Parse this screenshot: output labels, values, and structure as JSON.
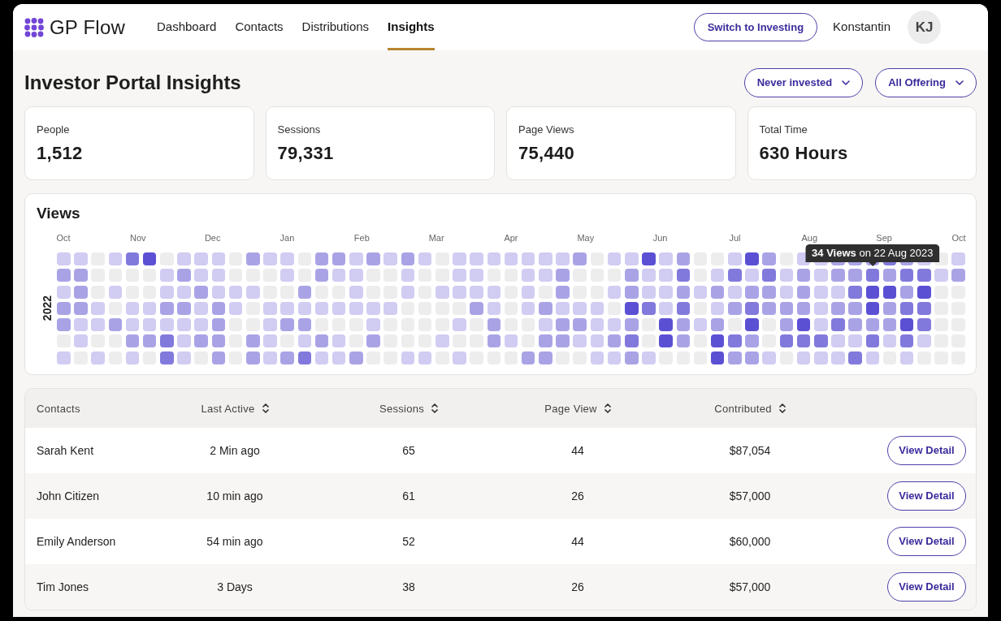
{
  "header": {
    "brand": "GP Flow",
    "nav": [
      {
        "label": "Dashboard",
        "selected": false
      },
      {
        "label": "Contacts",
        "selected": false
      },
      {
        "label": "Distributions",
        "selected": false
      },
      {
        "label": "Insights",
        "selected": true
      }
    ],
    "switch_button": "Switch to Investing",
    "user_name": "Konstantin",
    "avatar_initials": "KJ"
  },
  "page_title": "Investor Portal Insights",
  "filters": [
    {
      "label": "Never invested"
    },
    {
      "label": "All Offering"
    }
  ],
  "stats": [
    {
      "label": "People",
      "value": "1,512"
    },
    {
      "label": "Sessions",
      "value": "79,331"
    },
    {
      "label": "Page Views",
      "value": "75,440"
    },
    {
      "label": "Total Time",
      "value": "630 Hours"
    }
  ],
  "views": {
    "title": "Views",
    "year": "2022",
    "months": [
      "Oct",
      "Nov",
      "Dec",
      "Jan",
      "Feb",
      "Mar",
      "Apr",
      "May",
      "Jun",
      "Jul",
      "Aug",
      "Sep",
      "Oct"
    ],
    "rows": [
      {
        "cells": [
          {
            "color": "#d0ccf2"
          },
          {
            "color": "#d0ccf2"
          },
          {
            "color": "#ededed"
          },
          {
            "color": "#d0ccf2"
          },
          {
            "color": "#8279dc"
          },
          {
            "color": "#5b50d4"
          },
          {
            "color": "#ededed"
          },
          {
            "color": "#d0ccf2"
          },
          {
            "color": "#d0ccf2"
          },
          {
            "color": "#d0ccf2"
          },
          {
            "color": "#ededed"
          },
          {
            "color": "#a9a3e6"
          },
          {
            "color": "#d0ccf2"
          },
          {
            "color": "#d0ccf2"
          },
          {
            "color": "#ededed"
          },
          {
            "color": "#a9a3e6"
          },
          {
            "color": "#a9a3e6"
          },
          {
            "color": "#d0ccf2"
          },
          {
            "color": "#a9a3e6"
          },
          {
            "color": "#d0ccf2"
          },
          {
            "color": "#a9a3e6"
          },
          {
            "color": "#d0ccf2"
          },
          {
            "color": "#ededed"
          },
          {
            "color": "#d0ccf2"
          },
          {
            "color": "#d0ccf2"
          },
          {
            "color": "#d0ccf2"
          },
          {
            "color": "#d0ccf2"
          },
          {
            "color": "#d0ccf2"
          },
          {
            "color": "#d0ccf2"
          },
          {
            "color": "#d0ccf2"
          },
          {
            "color": "#a9a3e6"
          },
          {
            "color": "#ededed"
          },
          {
            "color": "#d0ccf2"
          },
          {
            "color": "#d0ccf2"
          },
          {
            "color": "#5b50d4"
          },
          {
            "color": "#d0ccf2"
          },
          {
            "color": "#a9a3e6"
          },
          {
            "color": "#ededed"
          },
          {
            "color": "#ededed"
          },
          {
            "color": "#d0ccf2"
          },
          {
            "color": "#5b50d4"
          },
          {
            "color": "#a9a3e6"
          },
          {
            "color": "#ededed"
          },
          {
            "color": "#d0ccf2"
          },
          {
            "color": "#d0ccf2"
          },
          {
            "color": "#a9a3e6"
          },
          {
            "color": "#a9a3e6"
          },
          {
            "color": "#a9a3e6"
          },
          {
            "color": "#8279dc"
          },
          {
            "color": "#a9a3e6"
          },
          {
            "color": "#d0ccf2"
          },
          {
            "color": "#ededed"
          },
          {
            "color": "#d0ccf2"
          }
        ]
      },
      {
        "cells": [
          {
            "color": "#a9a3e6"
          },
          {
            "color": "#a9a3e6"
          },
          {
            "color": "#ededed"
          },
          {
            "color": "#ededed"
          },
          {
            "color": "#ededed"
          },
          {
            "color": "#ededed"
          },
          {
            "color": "#d0ccf2"
          },
          {
            "color": "#a9a3e6"
          },
          {
            "color": "#d0ccf2"
          },
          {
            "color": "#d0ccf2"
          },
          {
            "color": "#ededed"
          },
          {
            "color": "#ededed"
          },
          {
            "color": "#ededed"
          },
          {
            "color": "#d0ccf2"
          },
          {
            "color": "#ededed"
          },
          {
            "color": "#a9a3e6"
          },
          {
            "color": "#d0ccf2"
          },
          {
            "color": "#d0ccf2"
          },
          {
            "color": "#ededed"
          },
          {
            "color": "#ededed"
          },
          {
            "color": "#d0ccf2"
          },
          {
            "color": "#ededed"
          },
          {
            "color": "#ededed"
          },
          {
            "color": "#d0ccf2"
          },
          {
            "color": "#d0ccf2"
          },
          {
            "color": "#ededed"
          },
          {
            "color": "#ededed"
          },
          {
            "color": "#d0ccf2"
          },
          {
            "color": "#d0ccf2"
          },
          {
            "color": "#a9a3e6"
          },
          {
            "color": "#ededed"
          },
          {
            "color": "#ededed"
          },
          {
            "color": "#ededed"
          },
          {
            "color": "#a9a3e6"
          },
          {
            "color": "#d0ccf2"
          },
          {
            "color": "#d0ccf2"
          },
          {
            "color": "#8279dc"
          },
          {
            "color": "#ededed"
          },
          {
            "color": "#d0ccf2"
          },
          {
            "color": "#8279dc"
          },
          {
            "color": "#d0ccf2"
          },
          {
            "color": "#8279dc"
          },
          {
            "color": "#d0ccf2"
          },
          {
            "color": "#a9a3e6"
          },
          {
            "color": "#d0ccf2"
          },
          {
            "color": "#a9a3e6"
          },
          {
            "color": "#a9a3e6"
          },
          {
            "color": "#8279dc",
            "tooltip": "**34 Views** on 22 Aug 2023"
          },
          {
            "color": "#a9a3e6"
          },
          {
            "color": "#8279dc"
          },
          {
            "color": "#8279dc"
          },
          {
            "color": "#d0ccf2"
          },
          {
            "color": "#a9a3e6"
          }
        ]
      },
      {
        "cells": [
          {
            "color": "#d0ccf2"
          },
          {
            "color": "#a9a3e6"
          },
          {
            "color": "#ededed"
          },
          {
            "color": "#d0ccf2"
          },
          {
            "color": "#ededed"
          },
          {
            "color": "#ededed"
          },
          {
            "color": "#d0ccf2"
          },
          {
            "color": "#d0ccf2"
          },
          {
            "color": "#a9a3e6"
          },
          {
            "color": "#d0ccf2"
          },
          {
            "color": "#d0ccf2"
          },
          {
            "color": "#d0ccf2"
          },
          {
            "color": "#ededed"
          },
          {
            "color": "#ededed"
          },
          {
            "color": "#a9a3e6"
          },
          {
            "color": "#ededed"
          },
          {
            "color": "#ededed"
          },
          {
            "color": "#d0ccf2"
          },
          {
            "color": "#ededed"
          },
          {
            "color": "#ededed"
          },
          {
            "color": "#d0ccf2"
          },
          {
            "color": "#ededed"
          },
          {
            "color": "#d0ccf2"
          },
          {
            "color": "#d0ccf2"
          },
          {
            "color": "#d0ccf2"
          },
          {
            "color": "#d0ccf2"
          },
          {
            "color": "#ededed"
          },
          {
            "color": "#d0ccf2"
          },
          {
            "color": "#ededed"
          },
          {
            "color": "#a9a3e6"
          },
          {
            "color": "#ededed"
          },
          {
            "color": "#ededed"
          },
          {
            "color": "#d0ccf2"
          },
          {
            "color": "#a9a3e6"
          },
          {
            "color": "#d0ccf2"
          },
          {
            "color": "#d0ccf2"
          },
          {
            "color": "#a9a3e6"
          },
          {
            "color": "#d0ccf2"
          },
          {
            "color": "#a9a3e6"
          },
          {
            "color": "#d0ccf2"
          },
          {
            "color": "#a9a3e6"
          },
          {
            "color": "#a9a3e6"
          },
          {
            "color": "#d0ccf2"
          },
          {
            "color": "#a9a3e6"
          },
          {
            "color": "#d0ccf2"
          },
          {
            "color": "#d0ccf2"
          },
          {
            "color": "#8279dc"
          },
          {
            "color": "#5b50d4"
          },
          {
            "color": "#5b50d4"
          },
          {
            "color": "#a9a3e6"
          },
          {
            "color": "#5b50d4"
          },
          {
            "color": "#ededed"
          },
          {
            "color": "#ededed"
          }
        ]
      },
      {
        "cells": [
          {
            "color": "#a9a3e6"
          },
          {
            "color": "#a9a3e6"
          },
          {
            "color": "#d0ccf2"
          },
          {
            "color": "#ededed"
          },
          {
            "color": "#d0ccf2"
          },
          {
            "color": "#d0ccf2"
          },
          {
            "color": "#a9a3e6"
          },
          {
            "color": "#a9a3e6"
          },
          {
            "color": "#d0ccf2"
          },
          {
            "color": "#a9a3e6"
          },
          {
            "color": "#d0ccf2"
          },
          {
            "color": "#ededed"
          },
          {
            "color": "#d0ccf2"
          },
          {
            "color": "#d0ccf2"
          },
          {
            "color": "#d0ccf2"
          },
          {
            "color": "#d0ccf2"
          },
          {
            "color": "#d0ccf2"
          },
          {
            "color": "#d0ccf2"
          },
          {
            "color": "#d0ccf2"
          },
          {
            "color": "#d0ccf2"
          },
          {
            "color": "#ededed"
          },
          {
            "color": "#ededed"
          },
          {
            "color": "#ededed"
          },
          {
            "color": "#ededed"
          },
          {
            "color": "#a9a3e6"
          },
          {
            "color": "#d0ccf2"
          },
          {
            "color": "#ededed"
          },
          {
            "color": "#d0ccf2"
          },
          {
            "color": "#a9a3e6"
          },
          {
            "color": "#d0ccf2"
          },
          {
            "color": "#d0ccf2"
          },
          {
            "color": "#d0ccf2"
          },
          {
            "color": "#ededed"
          },
          {
            "color": "#5b50d4"
          },
          {
            "color": "#8279dc"
          },
          {
            "color": "#d0ccf2"
          },
          {
            "color": "#8279dc"
          },
          {
            "color": "#ededed"
          },
          {
            "color": "#d0ccf2"
          },
          {
            "color": "#a9a3e6"
          },
          {
            "color": "#8279dc"
          },
          {
            "color": "#a9a3e6"
          },
          {
            "color": "#a9a3e6"
          },
          {
            "color": "#a9a3e6"
          },
          {
            "color": "#d0ccf2"
          },
          {
            "color": "#a9a3e6"
          },
          {
            "color": "#a9a3e6"
          },
          {
            "color": "#5b50d4"
          },
          {
            "color": "#a9a3e6"
          },
          {
            "color": "#8279dc"
          },
          {
            "color": "#8279dc"
          },
          {
            "color": "#ededed"
          },
          {
            "color": "#ededed"
          }
        ]
      },
      {
        "cells": [
          {
            "color": "#a9a3e6"
          },
          {
            "color": "#d0ccf2"
          },
          {
            "color": "#d0ccf2"
          },
          {
            "color": "#a9a3e6"
          },
          {
            "color": "#d0ccf2"
          },
          {
            "color": "#d0ccf2"
          },
          {
            "color": "#d0ccf2"
          },
          {
            "color": "#d0ccf2"
          },
          {
            "color": "#d0ccf2"
          },
          {
            "color": "#a9a3e6"
          },
          {
            "color": "#ededed"
          },
          {
            "color": "#ededed"
          },
          {
            "color": "#d0ccf2"
          },
          {
            "color": "#a9a3e6"
          },
          {
            "color": "#a9a3e6"
          },
          {
            "color": "#ededed"
          },
          {
            "color": "#ededed"
          },
          {
            "color": "#ededed"
          },
          {
            "color": "#d0ccf2"
          },
          {
            "color": "#ededed"
          },
          {
            "color": "#ededed"
          },
          {
            "color": "#ededed"
          },
          {
            "color": "#ededed"
          },
          {
            "color": "#d0ccf2"
          },
          {
            "color": "#ededed"
          },
          {
            "color": "#a9a3e6"
          },
          {
            "color": "#ededed"
          },
          {
            "color": "#ededed"
          },
          {
            "color": "#d0ccf2"
          },
          {
            "color": "#a9a3e6"
          },
          {
            "color": "#a9a3e6"
          },
          {
            "color": "#d0ccf2"
          },
          {
            "color": "#d0ccf2"
          },
          {
            "color": "#a9a3e6"
          },
          {
            "color": "#ededed"
          },
          {
            "color": "#5b50d4"
          },
          {
            "color": "#a9a3e6"
          },
          {
            "color": "#d0ccf2"
          },
          {
            "color": "#a9a3e6"
          },
          {
            "color": "#ededed"
          },
          {
            "color": "#5b50d4"
          },
          {
            "color": "#ededed"
          },
          {
            "color": "#a9a3e6"
          },
          {
            "color": "#5b50d4"
          },
          {
            "color": "#d0ccf2"
          },
          {
            "color": "#8279dc"
          },
          {
            "color": "#a9a3e6"
          },
          {
            "color": "#a9a3e6"
          },
          {
            "color": "#a9a3e6"
          },
          {
            "color": "#5b50d4"
          },
          {
            "color": "#8279dc"
          },
          {
            "color": "#ededed"
          },
          {
            "color": "#ededed"
          }
        ]
      },
      {
        "cells": [
          {
            "color": "#ededed"
          },
          {
            "color": "#d0ccf2"
          },
          {
            "color": "#ededed"
          },
          {
            "color": "#ededed"
          },
          {
            "color": "#a9a3e6"
          },
          {
            "color": "#a9a3e6"
          },
          {
            "color": "#8279dc"
          },
          {
            "color": "#d0ccf2"
          },
          {
            "color": "#a9a3e6"
          },
          {
            "color": "#a9a3e6"
          },
          {
            "color": "#ededed"
          },
          {
            "color": "#a9a3e6"
          },
          {
            "color": "#d0ccf2"
          },
          {
            "color": "#ededed"
          },
          {
            "color": "#d0ccf2"
          },
          {
            "color": "#a9a3e6"
          },
          {
            "color": "#d0ccf2"
          },
          {
            "color": "#ededed"
          },
          {
            "color": "#a9a3e6"
          },
          {
            "color": "#ededed"
          },
          {
            "color": "#ededed"
          },
          {
            "color": "#ededed"
          },
          {
            "color": "#d0ccf2"
          },
          {
            "color": "#ededed"
          },
          {
            "color": "#ededed"
          },
          {
            "color": "#a9a3e6"
          },
          {
            "color": "#d0ccf2"
          },
          {
            "color": "#ededed"
          },
          {
            "color": "#a9a3e6"
          },
          {
            "color": "#a9a3e6"
          },
          {
            "color": "#d0ccf2"
          },
          {
            "color": "#d0ccf2"
          },
          {
            "color": "#a9a3e6"
          },
          {
            "color": "#8279dc"
          },
          {
            "color": "#ededed"
          },
          {
            "color": "#5b50d4"
          },
          {
            "color": "#a9a3e6"
          },
          {
            "color": "#ededed"
          },
          {
            "color": "#5b50d4"
          },
          {
            "color": "#8279dc"
          },
          {
            "color": "#a9a3e6"
          },
          {
            "color": "#ededed"
          },
          {
            "color": "#8279dc"
          },
          {
            "color": "#8279dc"
          },
          {
            "color": "#8279dc"
          },
          {
            "color": "#d0ccf2"
          },
          {
            "color": "#d0ccf2"
          },
          {
            "color": "#8279dc"
          },
          {
            "color": "#d0ccf2"
          },
          {
            "color": "#8279dc"
          },
          {
            "color": "#d0ccf2"
          },
          {
            "color": "#ededed"
          },
          {
            "color": "#ededed"
          }
        ]
      },
      {
        "cells": [
          {
            "color": "#d0ccf2"
          },
          {
            "color": "#ededed"
          },
          {
            "color": "#d0ccf2"
          },
          {
            "color": "#ededed"
          },
          {
            "color": "#d0ccf2"
          },
          {
            "color": "#ededed"
          },
          {
            "color": "#8279dc"
          },
          {
            "color": "#d0ccf2"
          },
          {
            "color": "#ededed"
          },
          {
            "color": "#a9a3e6"
          },
          {
            "color": "#ededed"
          },
          {
            "color": "#a9a3e6"
          },
          {
            "color": "#d0ccf2"
          },
          {
            "color": "#a9a3e6"
          },
          {
            "color": "#8279dc"
          },
          {
            "color": "#d0ccf2"
          },
          {
            "color": "#d0ccf2"
          },
          {
            "color": "#a9a3e6"
          },
          {
            "color": "#ededed"
          },
          {
            "color": "#ededed"
          },
          {
            "color": "#d0ccf2"
          },
          {
            "color": "#d0ccf2"
          },
          {
            "color": "#ededed"
          },
          {
            "color": "#d0ccf2"
          },
          {
            "color": "#ededed"
          },
          {
            "color": "#ededed"
          },
          {
            "color": "#ededed"
          },
          {
            "color": "#a9a3e6"
          },
          {
            "color": "#a9a3e6"
          },
          {
            "color": "#ededed"
          },
          {
            "color": "#ededed"
          },
          {
            "color": "#d0ccf2"
          },
          {
            "color": "#d0ccf2"
          },
          {
            "color": "#a9a3e6"
          },
          {
            "color": "#d0ccf2"
          },
          {
            "color": "#ededed"
          },
          {
            "color": "#ededed"
          },
          {
            "color": "#ededed"
          },
          {
            "color": "#5b50d4"
          },
          {
            "color": "#a9a3e6"
          },
          {
            "color": "#a9a3e6"
          },
          {
            "color": "#d0ccf2"
          },
          {
            "color": "#ededed"
          },
          {
            "color": "#d0ccf2"
          },
          {
            "color": "#d0ccf2"
          },
          {
            "color": "#d0ccf2"
          },
          {
            "color": "#8279dc"
          },
          {
            "color": "#d0ccf2"
          },
          {
            "color": "#ededed"
          },
          {
            "color": "#d0ccf2"
          },
          {
            "color": "#ededed"
          },
          {
            "color": "#ededed"
          },
          {
            "color": "#ededed"
          }
        ]
      }
    ]
  },
  "table": {
    "columns": [
      {
        "label": "Contacts",
        "sortable": false
      },
      {
        "label": "Last Active",
        "sortable": true
      },
      {
        "label": "Sessions",
        "sortable": true
      },
      {
        "label": "Page View",
        "sortable": true
      },
      {
        "label": "Contributed",
        "sortable": true
      }
    ],
    "rows": [
      {
        "cells": [
          "Sarah Kent",
          "2 Min ago",
          "65",
          "44",
          "$87,054"
        ],
        "action": "View Detail"
      },
      {
        "cells": [
          "John Citizen",
          "10 min ago",
          "61",
          "26",
          "$57,000"
        ],
        "action": "View Detail"
      },
      {
        "cells": [
          "Emily Anderson",
          "54 min ago",
          "52",
          "44",
          "$60,000"
        ],
        "action": "View Detail"
      },
      {
        "cells": [
          "Tim Jones",
          "3 Days",
          "38",
          "26",
          "$57,000"
        ],
        "action": "View Detail"
      }
    ]
  }
}
